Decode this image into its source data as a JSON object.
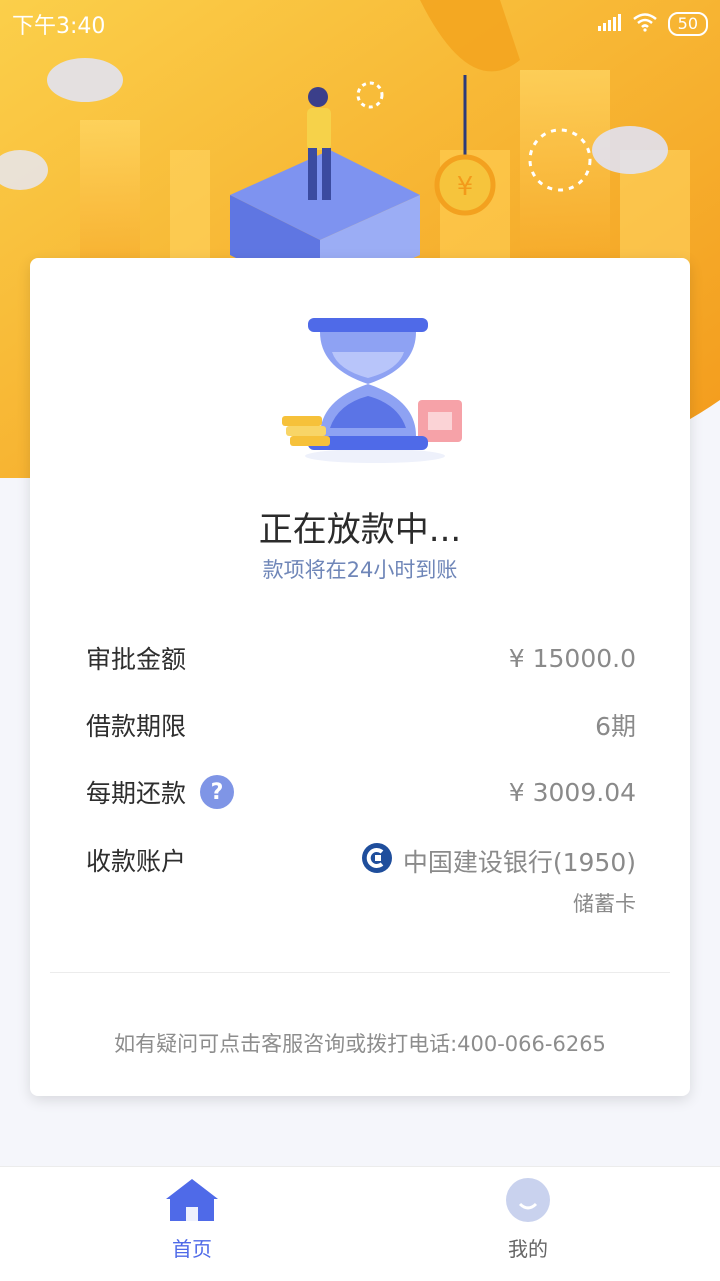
{
  "status_bar": {
    "time": "下午3:40",
    "battery": "50"
  },
  "status": {
    "title": "正在放款中...",
    "subtitle": "款项将在24小时到账"
  },
  "details": {
    "approved_amount": {
      "label": "审批金额",
      "value": "¥ 15000.0"
    },
    "term": {
      "label": "借款期限",
      "value": "6期"
    },
    "installment": {
      "label": "每期还款",
      "value": "¥ 3009.04",
      "help": "?"
    },
    "account": {
      "label": "收款账户",
      "bank": "中国建设银行(1950)",
      "type": "储蓄卡"
    }
  },
  "footer_note": "如有疑问可点击客服咨询或拨打电话:400-066-6265",
  "tabs": [
    {
      "label": "首页",
      "icon": "home-icon",
      "active": true
    },
    {
      "label": "我的",
      "icon": "profile-icon",
      "active": false
    }
  ],
  "colors": {
    "hero_orange": "#f7b52b",
    "accent_blue": "#4f6ae8",
    "subtitle_blue": "#6f86b8"
  }
}
